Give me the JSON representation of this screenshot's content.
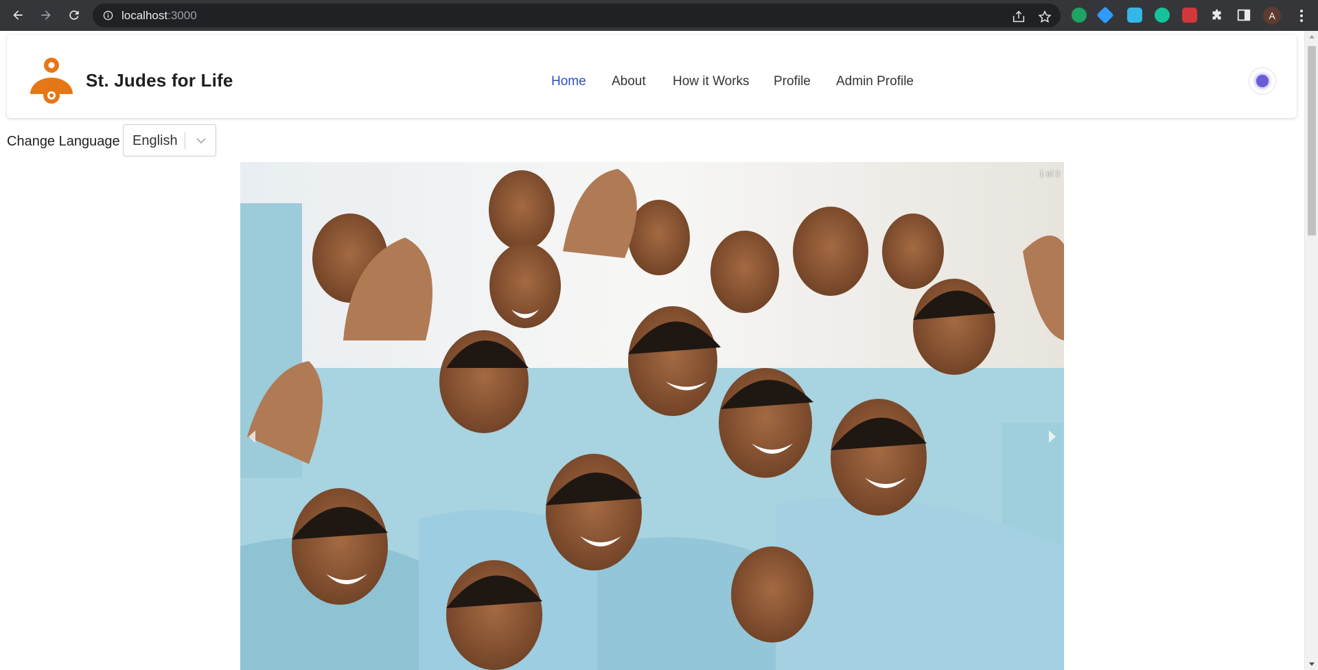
{
  "browser": {
    "url_host": "localhost",
    "url_port": ":3000",
    "avatar_initial": "A",
    "extensions": [
      "chat-extension-icon",
      "gem-extension-icon",
      "pen-extension-icon",
      "grammarly-icon",
      "puzzle-red-extension-icon"
    ]
  },
  "navbar": {
    "brand": "St. Judes for Life",
    "links": [
      {
        "label": "Home",
        "active": true
      },
      {
        "label": "About",
        "active": false
      },
      {
        "label": "How it Works",
        "active": false
      },
      {
        "label": "Profile",
        "active": false
      },
      {
        "label": "Admin Profile",
        "active": false
      }
    ]
  },
  "language": {
    "label": "Change Language",
    "selected": "English"
  },
  "carousel": {
    "counter": "1 of 3"
  },
  "colors": {
    "brand_orange": "#e67717",
    "active_link": "#2a4fc2",
    "toggle_dot": "#6a5bd6"
  }
}
